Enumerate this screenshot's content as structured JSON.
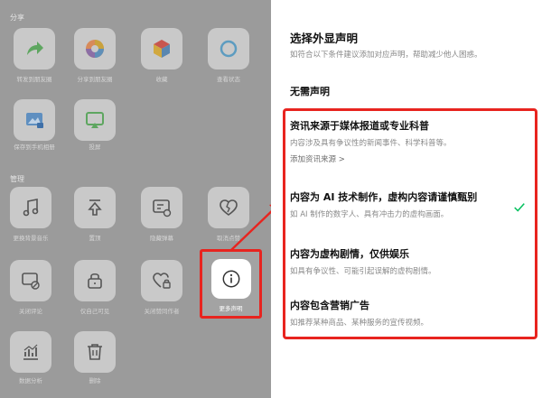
{
  "left": {
    "sections": [
      {
        "label": "分享",
        "items": [
          {
            "label": "转发到朋友圈",
            "icon": "forward-icon"
          },
          {
            "label": "分享到朋友圈",
            "icon": "moments-icon"
          },
          {
            "label": "收藏",
            "icon": "favorite-icon"
          },
          {
            "label": "查看状态",
            "icon": "status-icon"
          },
          {
            "label": "保存到手机相册",
            "icon": "save-image-icon"
          },
          {
            "label": "投屏",
            "icon": "cast-icon"
          }
        ]
      },
      {
        "label": "管理",
        "items": [
          {
            "label": "更换背景音乐",
            "icon": "music-icon"
          },
          {
            "label": "置顶",
            "icon": "pin-top-icon"
          },
          {
            "label": "隐藏弹幕",
            "icon": "danmaku-icon"
          },
          {
            "label": "取消点赞",
            "icon": "heart-broken-icon"
          },
          {
            "label": "关闭评论",
            "icon": "comment-off-icon"
          },
          {
            "label": "仅自己可见",
            "icon": "lock-icon"
          },
          {
            "label": "关闭赞同作者",
            "icon": "heart-lock-icon"
          },
          {
            "label": "数据分析",
            "icon": "analytics-icon"
          },
          {
            "label": "删除",
            "icon": "trash-icon"
          }
        ]
      }
    ],
    "more": {
      "label": "更多声明",
      "icon": "info-icon"
    }
  },
  "right": {
    "title": "选择外显声明",
    "subtitle": "如符合以下条件建议添加对应声明，帮助减少他人困惑。",
    "none_label": "无需声明",
    "options": [
      {
        "title": "资讯来源于媒体报道或专业科普",
        "desc": "内容涉及具有争议性的新闻事件、科学科普等。",
        "link": "添加资讯来源 >"
      },
      {
        "title": "内容为 AI 技术制作，虚构内容请谨慎甄别",
        "desc": "如 AI 制作的数字人、具有冲击力的虚构画面。",
        "selected": true
      },
      {
        "title": "内容为虚构剧情，仅供娱乐",
        "desc": "如具有争议性、可能引起误解的虚构剧情。"
      },
      {
        "title": "内容包含营销广告",
        "desc": "如推荐某种商品、某种服务的宣传视频。"
      }
    ]
  },
  "colors": {
    "highlight": "#e8241f",
    "check": "#07c160"
  }
}
